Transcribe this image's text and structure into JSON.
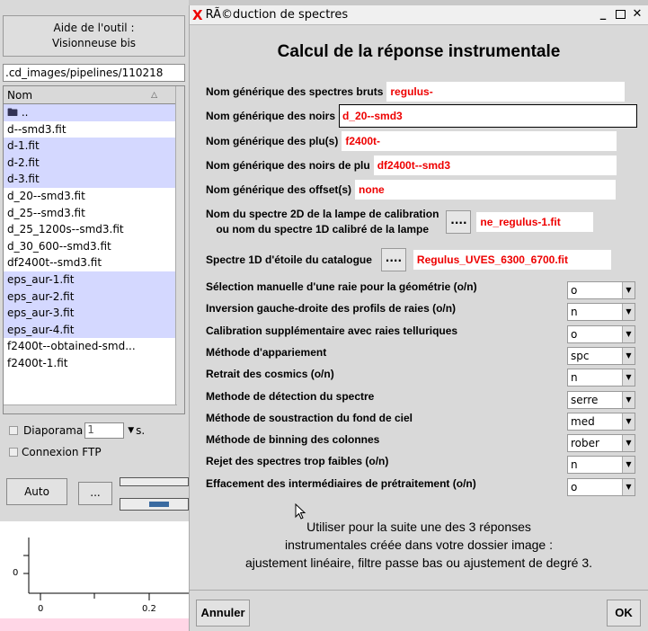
{
  "left_panel": {
    "aide_button": {
      "line1": "Aide de l'outil :",
      "line2": "Visionneuse bis"
    },
    "path": ".cd_images/pipelines/110218",
    "file_list": {
      "column_header": "Nom",
      "items": [
        "..",
        "d--smd3.fit",
        "d-1.fit",
        "d-2.fit",
        "d-3.fit",
        "d_20--smd3.fit",
        "d_25--smd3.fit",
        "d_25_1200s--smd3.fit",
        "d_30_600--smd3.fit",
        "df2400t--smd3.fit",
        "eps_aur-1.fit",
        "eps_aur-2.fit",
        "eps_aur-3.fit",
        "eps_aur-4.fit",
        "f2400t--obtained-smd...",
        "f2400t-1.fit"
      ]
    },
    "diaporama": {
      "label": "Diaporama",
      "value": "1",
      "unit": "s."
    },
    "ftp_label": "Connexion FTP",
    "auto_button": "Auto",
    "dots_button": "...",
    "plot": {
      "ytick": "0",
      "xticks": [
        "0",
        "0.2"
      ]
    }
  },
  "dialog": {
    "window_title": "RÃ©duction de spectres",
    "heading": "Calcul de la réponse instrumentale",
    "fields": {
      "bruts": {
        "label": "Nom générique des spectres bruts",
        "value": "regulus-"
      },
      "noirs": {
        "label": "Nom générique des noirs",
        "value": "d_20--smd3"
      },
      "plu": {
        "label": "Nom générique des plu(s)",
        "value": "f2400t-"
      },
      "noirsplu": {
        "label": "Nom générique des noirs de plu",
        "value": "df2400t--smd3"
      },
      "offset": {
        "label": "Nom générique des offset(s)",
        "value": "none"
      }
    },
    "lampe": {
      "label_line1": "Nom du spectre 2D de la lampe de calibration",
      "label_line2": "ou nom du spectre 1D calibré de la lampe",
      "button": "....",
      "value": "ne_regulus-1.fit"
    },
    "catalogue": {
      "label": "Spectre 1D d'étoile du catalogue",
      "button": "....",
      "value": "Regulus_UVES_6300_6700.fit"
    },
    "options": [
      {
        "label": "Sélection manuelle d'une raie pour la géométrie (o/n)",
        "value": "o"
      },
      {
        "label": "Inversion gauche-droite des profils de raies (o/n)",
        "value": "n"
      },
      {
        "label": "Calibration supplémentaire avec raies telluriques",
        "value": "o"
      },
      {
        "label": "Méthode d'appariement",
        "value": "spc"
      },
      {
        "label": "Retrait des cosmics (o/n)",
        "value": "n"
      },
      {
        "label": "Methode de détection du spectre",
        "value": "serre"
      },
      {
        "label": "Méthode de soustraction du fond de ciel",
        "value": "med"
      },
      {
        "label": "Méthode de binning des colonnes",
        "value": "rober"
      },
      {
        "label": "Rejet des spectres trop faibles (o/n)",
        "value": "n"
      },
      {
        "label": "Effacement des intermédiaires de prétraitement (o/n)",
        "value": "o"
      }
    ],
    "info": {
      "line1": "Utiliser pour la suite une des 3 réponses",
      "line2": "instrumentales créée dans votre dossier image :",
      "line3": "ajustement linéaire, filtre passe bas ou ajustement de degré 3."
    },
    "annuler_button": "Annuler",
    "ok_button": "OK"
  }
}
